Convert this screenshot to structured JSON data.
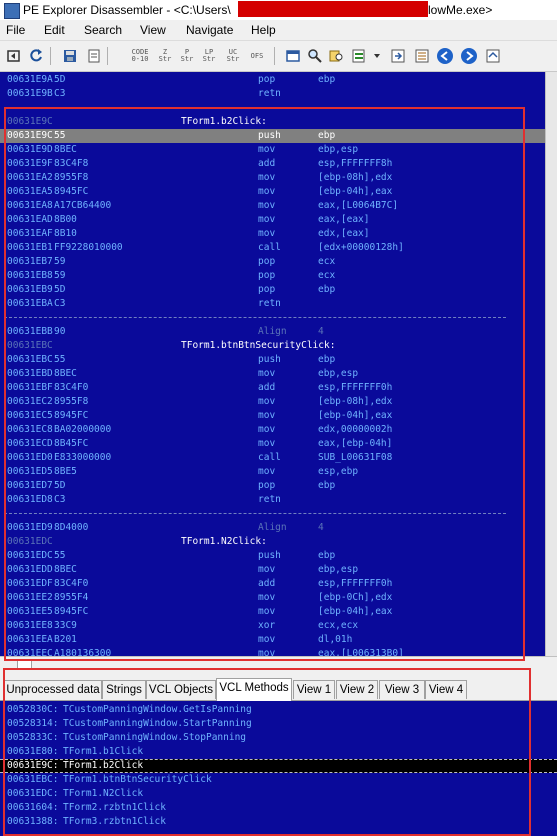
{
  "window": {
    "title_left": "PE Explorer Disassembler - <C:\\Users\\",
    "title_right": "lowMe.exe>"
  },
  "menu": [
    "File",
    "Edit",
    "Search",
    "View",
    "Navigate",
    "Help"
  ],
  "toolbar": {
    "code_btn": "CODE\n0-10",
    "zstr_btn": "Z\nStr",
    "pstr_btn": "P\nStr",
    "lpstr_btn": "LP\nStr",
    "ucstr_btn": "UC\nStr",
    "ofs_btn": "OFS"
  },
  "disassembly": [
    {
      "addr": "00631E9A",
      "hex": "5D",
      "mnem": "pop",
      "ops": "ebp"
    },
    {
      "addr": "00631E9B",
      "hex": "C3",
      "mnem": "retn",
      "ops": ""
    },
    {
      "sep": true
    },
    {
      "addr": "00631E9C",
      "label": "TForm1.b2Click:"
    },
    {
      "addr": "00631E9C",
      "hex": "55",
      "mnem": "push",
      "ops": "ebp",
      "selected": true
    },
    {
      "addr": "00631E9D",
      "hex": "8BEC",
      "mnem": "mov",
      "ops": "ebp,esp"
    },
    {
      "addr": "00631E9F",
      "hex": "83C4F8",
      "mnem": "add",
      "ops": "esp,FFFFFFF8h"
    },
    {
      "addr": "00631EA2",
      "hex": "8955F8",
      "mnem": "mov",
      "ops": "[ebp-08h],edx"
    },
    {
      "addr": "00631EA5",
      "hex": "8945FC",
      "mnem": "mov",
      "ops": "[ebp-04h],eax"
    },
    {
      "addr": "00631EA8",
      "hex": "A17CB64400",
      "mnem": "mov",
      "ops": "eax,[L0064B7C]"
    },
    {
      "addr": "00631EAD",
      "hex": "8B00",
      "mnem": "mov",
      "ops": "eax,[eax]"
    },
    {
      "addr": "00631EAF",
      "hex": "8B10",
      "mnem": "mov",
      "ops": "edx,[eax]"
    },
    {
      "addr": "00631EB1",
      "hex": "FF9228010000",
      "mnem": "call",
      "ops": "[edx+00000128h]"
    },
    {
      "addr": "00631EB7",
      "hex": "59",
      "mnem": "pop",
      "ops": "ecx"
    },
    {
      "addr": "00631EB8",
      "hex": "59",
      "mnem": "pop",
      "ops": "ecx"
    },
    {
      "addr": "00631EB9",
      "hex": "5D",
      "mnem": "pop",
      "ops": "ebp"
    },
    {
      "addr": "00631EBA",
      "hex": "C3",
      "mnem": "retn",
      "ops": ""
    },
    {
      "sep": true
    },
    {
      "addr": "00631EBB",
      "hex": "90",
      "mnem": "Align",
      "ops": "4",
      "align": true
    },
    {
      "addr": "00631EBC",
      "label": "TForm1.btnBtnSecurityClick:"
    },
    {
      "addr": "00631EBC",
      "hex": "55",
      "mnem": "push",
      "ops": "ebp"
    },
    {
      "addr": "00631EBD",
      "hex": "8BEC",
      "mnem": "mov",
      "ops": "ebp,esp"
    },
    {
      "addr": "00631EBF",
      "hex": "83C4F0",
      "mnem": "add",
      "ops": "esp,FFFFFFF0h"
    },
    {
      "addr": "00631EC2",
      "hex": "8955F8",
      "mnem": "mov",
      "ops": "[ebp-08h],edx"
    },
    {
      "addr": "00631EC5",
      "hex": "8945FC",
      "mnem": "mov",
      "ops": "[ebp-04h],eax"
    },
    {
      "addr": "00631EC8",
      "hex": "BA02000000",
      "mnem": "mov",
      "ops": "edx,00000002h"
    },
    {
      "addr": "00631ECD",
      "hex": "8B45FC",
      "mnem": "mov",
      "ops": "eax,[ebp-04h]"
    },
    {
      "addr": "00631ED0",
      "hex": "E833000000",
      "mnem": "call",
      "ops": "SUB_L00631F08"
    },
    {
      "addr": "00631ED5",
      "hex": "8BE5",
      "mnem": "mov",
      "ops": "esp,ebp"
    },
    {
      "addr": "00631ED7",
      "hex": "5D",
      "mnem": "pop",
      "ops": "ebp"
    },
    {
      "addr": "00631ED8",
      "hex": "C3",
      "mnem": "retn",
      "ops": ""
    },
    {
      "sep": true
    },
    {
      "addr": "00631ED9",
      "hex": "8D4000",
      "mnem": "Align",
      "ops": "4",
      "align": true
    },
    {
      "addr": "00631EDC",
      "label": "TForm1.N2Click:"
    },
    {
      "addr": "00631EDC",
      "hex": "55",
      "mnem": "push",
      "ops": "ebp"
    },
    {
      "addr": "00631EDD",
      "hex": "8BEC",
      "mnem": "mov",
      "ops": "ebp,esp"
    },
    {
      "addr": "00631EDF",
      "hex": "83C4F0",
      "mnem": "add",
      "ops": "esp,FFFFFFF0h"
    },
    {
      "addr": "00631EE2",
      "hex": "8955F4",
      "mnem": "mov",
      "ops": "[ebp-0Ch],edx"
    },
    {
      "addr": "00631EE5",
      "hex": "8945FC",
      "mnem": "mov",
      "ops": "[ebp-04h],eax"
    },
    {
      "addr": "00631EE8",
      "hex": "33C9",
      "mnem": "xor",
      "ops": "ecx,ecx"
    },
    {
      "addr": "00631EEA",
      "hex": "B201",
      "mnem": "mov",
      "ops": "dl,01h"
    },
    {
      "addr": "00631EEC",
      "hex": "A180136300",
      "mnem": "mov",
      "ops": "eax,[L006313B0]"
    }
  ],
  "tabs": [
    {
      "label": "Unprocessed data"
    },
    {
      "label": "Strings"
    },
    {
      "label": "VCL Objects"
    },
    {
      "label": "VCL Methods",
      "active": true
    },
    {
      "label": "View 1"
    },
    {
      "label": "View 2"
    },
    {
      "label": "View 3"
    },
    {
      "label": "View 4"
    }
  ],
  "vcl_methods": [
    {
      "addr": "0052830C:",
      "name": "TCustomPanningWindow.GetIsPanning"
    },
    {
      "addr": "00528314:",
      "name": "TCustomPanningWindow.StartPanning"
    },
    {
      "addr": "0052833C:",
      "name": "TCustomPanningWindow.StopPanning"
    },
    {
      "addr": "00631E80:",
      "name": "TForm1.b1Click"
    },
    {
      "addr": "00631E9C:",
      "name": "TForm1.b2Click",
      "selected": true
    },
    {
      "addr": "00631EBC:",
      "name": "TForm1.btnBtnSecurityClick"
    },
    {
      "addr": "00631EDC:",
      "name": "TForm1.N2Click"
    },
    {
      "addr": "00631604:",
      "name": "TForm2.rzbtn1Click"
    },
    {
      "addr": "00631388:",
      "name": "TForm3.rzbtn1Click"
    }
  ],
  "colors": {
    "listing_bg": "#0a0a9a",
    "listing_text": "#6fb3ff",
    "label_text": "#ffffff",
    "selection_bg": "#808080",
    "highlight_box": "#e03030"
  }
}
